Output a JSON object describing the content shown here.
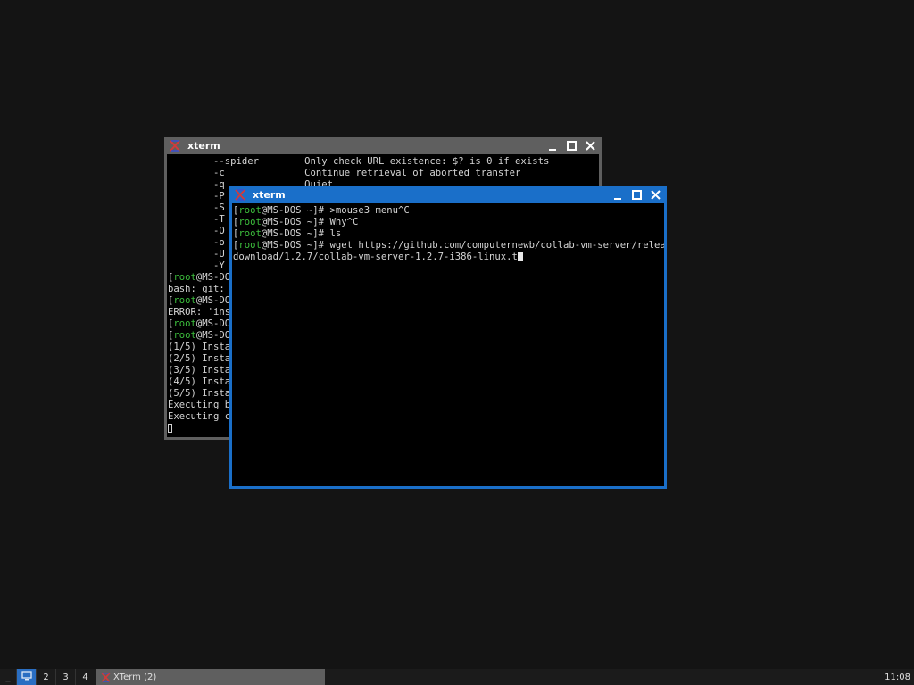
{
  "windows": {
    "back": {
      "title": "xterm",
      "lines": [
        "        --spider        Only check URL existence: $? is 0 if exists",
        "        -c              Continue retrieval of aborted transfer",
        "        -q              Quiet",
        "        -P",
        "        -S",
        "        -T",
        "        -O",
        "        -o",
        "        -U",
        "        -Y"
      ],
      "prompt_user": "root",
      "prompt_host": "@MS-DOS",
      "tail_lines": [
        {
          "kind": "prompt"
        },
        {
          "kind": "text",
          "text": "bash: git: c"
        },
        {
          "kind": "prompt"
        },
        {
          "kind": "text",
          "text": "ERROR: 'ins"
        },
        {
          "kind": "prompt"
        },
        {
          "kind": "prompt"
        },
        {
          "kind": "text",
          "text": "(1/5) Insta"
        },
        {
          "kind": "text",
          "text": "(2/5) Insta"
        },
        {
          "kind": "text",
          "text": "(3/5) Insta"
        },
        {
          "kind": "text",
          "text": "(4/5) Insta"
        },
        {
          "kind": "text",
          "text": "(5/5) Insta"
        },
        {
          "kind": "text",
          "text": "Executing bu"
        },
        {
          "kind": "text",
          "text": "Executing c"
        }
      ]
    },
    "front": {
      "title": "xterm",
      "prompt_user": "root",
      "prompt_host": "@MS-DOS",
      "prompt_suffix": " ~]# ",
      "commands": [
        ">mouse3 menu^C",
        "Why^C",
        "ls",
        "wget https://github.com/computernewb/collab-vm-server/releases/"
      ],
      "wrapped_line": "download/1.2.7/collab-vm-server-1.2.7-i386-linux.t"
    }
  },
  "taskbar": {
    "minimize_label": "_",
    "workspaces": [
      "1",
      "2",
      "3",
      "4"
    ],
    "active_workspace_icon": "monitor-icon",
    "task_label": "XTerm (2)",
    "clock": "11:08"
  },
  "colors": {
    "desktop": "#141414",
    "active_border": "#1a6fc9",
    "inactive_border": "#5f5f5f",
    "prompt_user": "#3cbd3c"
  }
}
